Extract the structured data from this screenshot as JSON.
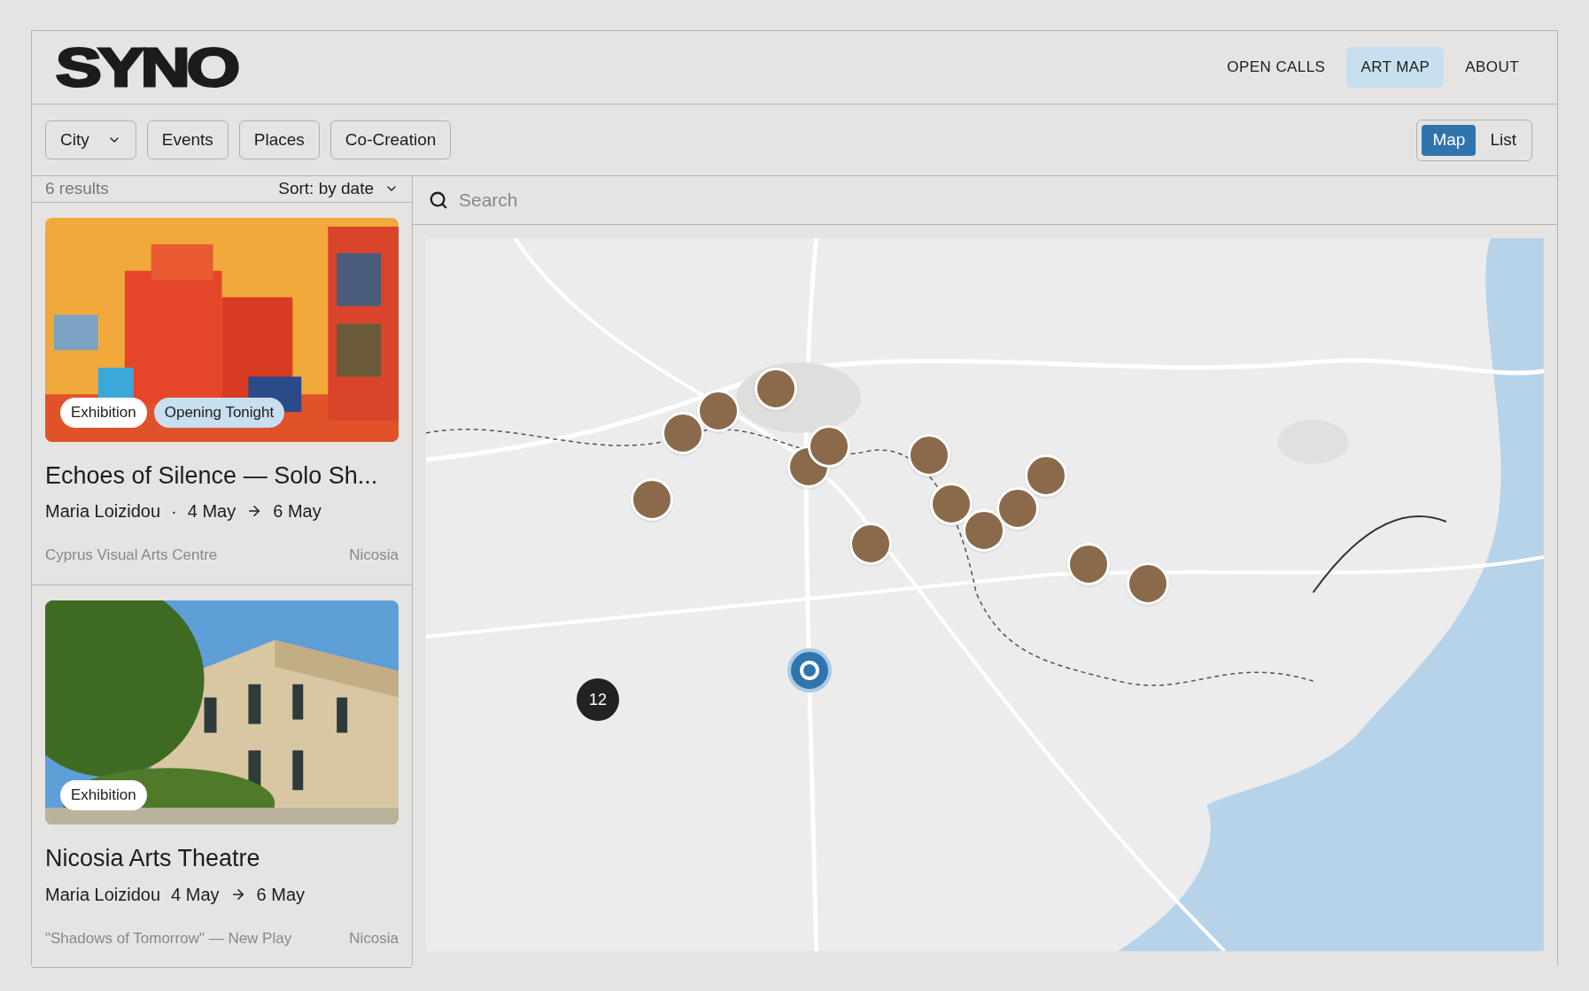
{
  "logo": "SYNO",
  "nav": [
    {
      "label": "OPEN CALLS",
      "selected": false
    },
    {
      "label": "ART MAP",
      "selected": true
    },
    {
      "label": "ABOUT",
      "selected": false
    }
  ],
  "filters": [
    {
      "label": "City",
      "kind": "dropdown"
    },
    {
      "label": "Events",
      "kind": "button"
    },
    {
      "label": "Places",
      "kind": "button"
    },
    {
      "label": "Co-Creation",
      "kind": "button"
    }
  ],
  "view_toggle": [
    {
      "label": "Map",
      "selected": true
    },
    {
      "label": "List",
      "selected": false
    }
  ],
  "results_count": "6 results",
  "sort": "Sort: by date",
  "search": {
    "placeholder": "Search"
  },
  "cards": [
    {
      "tags": [
        {
          "label": "Exhibition",
          "kind": "plain"
        },
        {
          "label": "Opening Tonight",
          "kind": "highlight"
        }
      ],
      "title": "Echoes of Silence — Solo Sh...",
      "artist": "Maria Loizidou",
      "separator": "·",
      "start": "4 May",
      "end": "6 May",
      "venue": "Cyprus Visual Arts Centre",
      "city": "Nicosia"
    },
    {
      "tags": [
        {
          "label": "Exhibition",
          "kind": "plain"
        }
      ],
      "title": "Nicosia Arts Theatre",
      "artist": "Maria Loizidou",
      "start": "4 May",
      "end": "6 May",
      "venue": "\"Shadows of Tomorrow\" — New Play",
      "city": "Nicosia"
    }
  ],
  "map": {
    "cluster": "12"
  }
}
